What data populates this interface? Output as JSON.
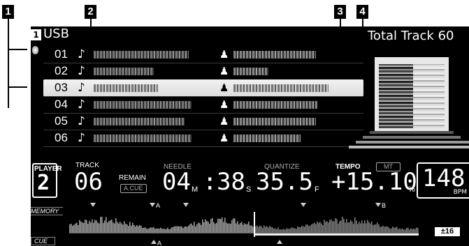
{
  "callouts": [
    "1",
    "2",
    "3",
    "4"
  ],
  "header": {
    "source_badge": "1",
    "source_label": "USB",
    "total_tracks": "Total Track 60"
  },
  "track_list": [
    {
      "number": "01",
      "selected": false
    },
    {
      "number": "02",
      "selected": false
    },
    {
      "number": "03",
      "selected": true
    },
    {
      "number": "04",
      "selected": false
    },
    {
      "number": "05",
      "selected": false
    },
    {
      "number": "06",
      "selected": false
    }
  ],
  "icons": {
    "note": "♪",
    "artist": "♟"
  },
  "player": {
    "label": "PLAYER",
    "number": "2"
  },
  "track": {
    "label": "TRACK",
    "value": "06"
  },
  "remain": {
    "label": "REMAIN",
    "acue": "A.CUE"
  },
  "needle": {
    "label": "NEEDLE",
    "minutes": "04",
    "m_unit": "M",
    "colon": ":",
    "seconds": "38",
    "s_unit": "S",
    "frames": "35.5",
    "f_unit": "F"
  },
  "quantize": {
    "label": "QUANTIZE"
  },
  "tempo": {
    "label": "TEMPO",
    "mt": "MT",
    "value": "+15.10",
    "unit": "%"
  },
  "bpm": {
    "value": "148",
    "unit": "BPM"
  },
  "side_tags": {
    "memory": "MEMORY",
    "cue": "CUE"
  },
  "markers": {
    "a": "A",
    "b": "B"
  },
  "tempo_range": "±16",
  "playback_position": 0.53
}
